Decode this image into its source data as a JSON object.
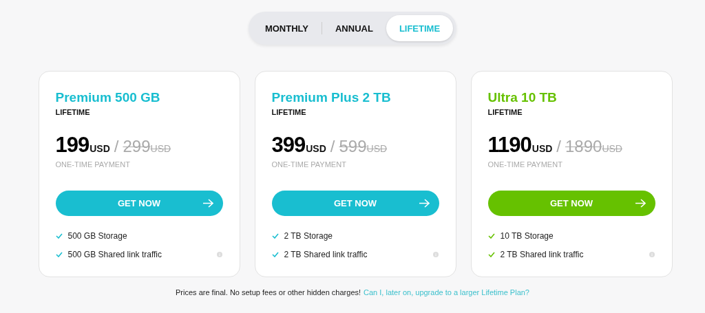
{
  "billing_tabs": [
    {
      "label": "MONTHLY",
      "selected": false
    },
    {
      "label": "ANNUAL",
      "selected": false
    },
    {
      "label": "LIFETIME",
      "selected": true
    }
  ],
  "plans": [
    {
      "name": "Premium 500 GB",
      "color": "#19bed0",
      "period": "LIFETIME",
      "price": "199",
      "currency": "USD",
      "separator": "/",
      "old_price": "299",
      "old_currency": "USD",
      "price_note": "ONE-TIME PAYMENT",
      "button": "GET NOW",
      "features": [
        "500 GB Storage",
        "500 GB Shared link traffic"
      ]
    },
    {
      "name": "Premium Plus 2 TB",
      "color": "#19bed0",
      "period": "LIFETIME",
      "price": "399",
      "currency": "USD",
      "separator": "/",
      "old_price": "599",
      "old_currency": "USD",
      "price_note": "ONE-TIME PAYMENT",
      "button": "GET NOW",
      "features": [
        "2 TB Storage",
        "2 TB Shared link traffic"
      ]
    },
    {
      "name": "Ultra 10 TB",
      "color": "#66c100",
      "period": "LIFETIME",
      "price": "1190",
      "currency": "USD",
      "separator": "/",
      "old_price": "1890",
      "old_currency": "USD",
      "price_note": "ONE-TIME PAYMENT",
      "button": "GET NOW",
      "features": [
        "10 TB Storage",
        "2 TB Shared link traffic"
      ]
    }
  ],
  "footer": {
    "note": "Prices are final. No setup fees or other hidden charges!",
    "link": "Can I, later on, upgrade to a larger Lifetime Plan?"
  }
}
